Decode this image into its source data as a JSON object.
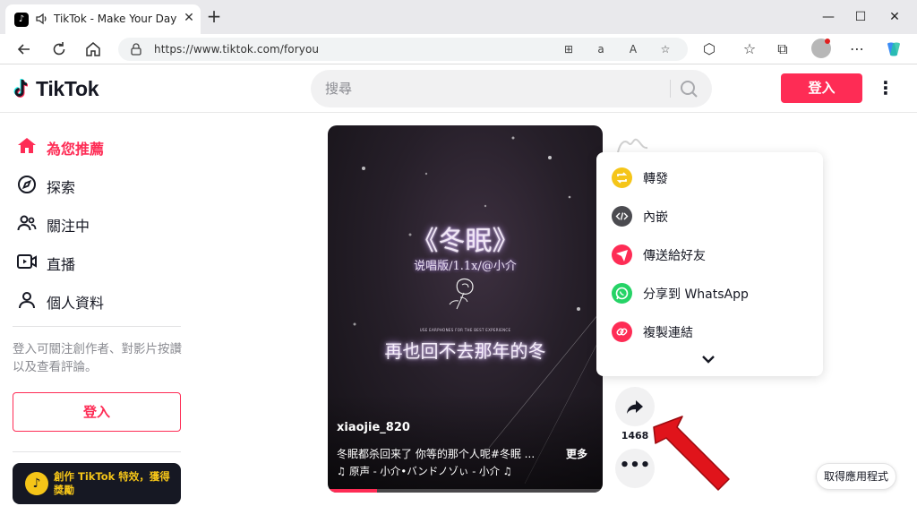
{
  "browser": {
    "tab_title": "TikTok - Make Your Day",
    "tab_close": "✕",
    "new_tab": "+",
    "url": "https://www.tiktok.com/foryou",
    "window_controls": {
      "minimize": "—",
      "maximize": "☐",
      "close": "✕"
    }
  },
  "header": {
    "logo_text": "TikTok",
    "search_placeholder": "搜尋",
    "login_button": "登入",
    "more_menu": "⋮"
  },
  "sidebar": {
    "items": [
      {
        "label": "為您推薦",
        "icon": "home-icon",
        "active": true
      },
      {
        "label": "探索",
        "icon": "compass-icon",
        "active": false
      },
      {
        "label": "關注中",
        "icon": "following-icon",
        "active": false
      },
      {
        "label": "直播",
        "icon": "live-icon",
        "active": false
      },
      {
        "label": "個人資料",
        "icon": "profile-icon",
        "active": false
      }
    ],
    "login_hint": "登入可關注創作者、對影片按讚以及查看評論。",
    "login_button": "登入",
    "effect_card": "創作 TikTok 特效，獲得獎勵"
  },
  "video": {
    "title": "《冬眠》",
    "subtitle": "说唱版/1.1x/@小介",
    "tiny_caption": "USE EARPHONES FOR THE BEST EXPERIENCE",
    "lyric": "再也回不去那年的冬",
    "author": "xiaojie_820",
    "description": "冬眠都杀回来了 你等的那个人呢#冬眠 ...",
    "more": "更多",
    "music": "♫ 原声 - 小介•バンドノゾぃ - 小介 ♫",
    "progress": 0.18
  },
  "actions": {
    "share_count": "1468"
  },
  "share_menu": {
    "items": [
      {
        "label": "轉發",
        "icon": "repost-icon",
        "color": "#f5c518"
      },
      {
        "label": "內嵌",
        "icon": "embed-icon",
        "color": "#4b4b50"
      },
      {
        "label": "傳送給好友",
        "icon": "send-icon",
        "color": "#fe2c55"
      },
      {
        "label": "分享到 WhatsApp",
        "icon": "whatsapp-icon",
        "color": "#25d366"
      },
      {
        "label": "複製連結",
        "icon": "link-icon",
        "color": "#fe2c55"
      }
    ]
  },
  "get_app": "取得應用程式",
  "colors": {
    "brand": "#fe2c55",
    "text": "#161823",
    "muted": "#8a8b91",
    "annotation_arrow": "#e0141b"
  }
}
